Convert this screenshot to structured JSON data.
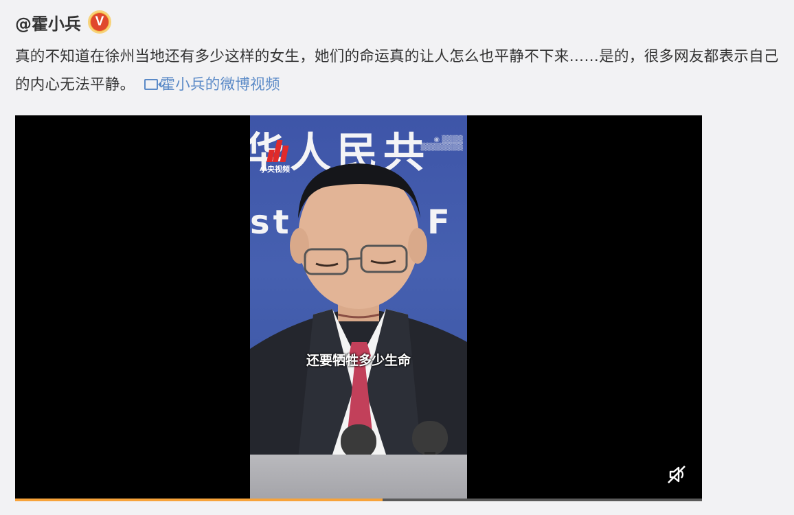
{
  "post": {
    "username": "@霍小兵",
    "verified_badge": "V",
    "text": "真的不知道在徐州当地还有多少这样的女生，她们的命运真的让人怎么也平静不下来……是的，很多网友都表示自己的内心无法平静。",
    "video_link_label": "霍小兵的微博视频"
  },
  "video": {
    "backdrop_text_top": "华人民共",
    "backdrop_text_mid": "st",
    "backdrop_text_mid_right": "F",
    "channel_logo_label": "小央视频",
    "subtitle": "还要牺牲多少生命",
    "progress": 0.535,
    "muted": true,
    "mute_icon": "volume-muted-icon"
  },
  "colors": {
    "link": "#5b8ac7",
    "progress": "#f7a33a",
    "badge": "#e0482d"
  }
}
